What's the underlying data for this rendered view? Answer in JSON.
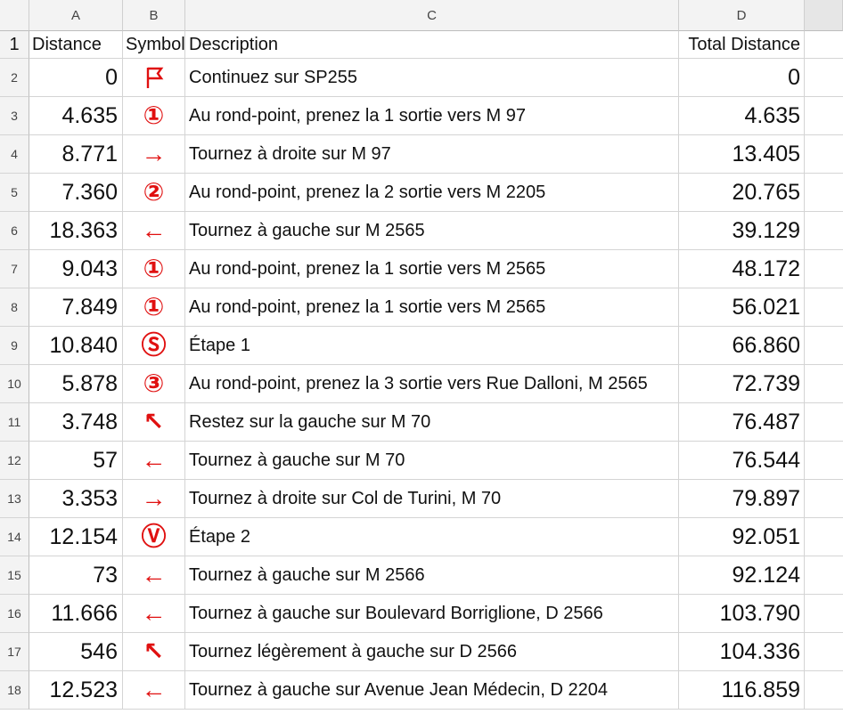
{
  "columns": [
    "A",
    "B",
    "C",
    "D"
  ],
  "header_labels": {
    "distance": "Distance",
    "symbol": "Symbol",
    "description": "Description",
    "total": "Total Distance"
  },
  "row_numbers": [
    "1",
    "2",
    "3",
    "4",
    "5",
    "6",
    "7",
    "8",
    "9",
    "10",
    "11",
    "12",
    "13",
    "14",
    "15",
    "16",
    "17",
    "18"
  ],
  "rows": [
    {
      "distance": "0",
      "symbol": "",
      "icon": "flag-icon",
      "description": "Continuez sur SP255",
      "total": "0"
    },
    {
      "distance": "4.635",
      "symbol": "①",
      "icon": "roundabout-exit-1-icon",
      "description": "Au rond-point, prenez la 1 sortie vers M 97",
      "total": "4.635"
    },
    {
      "distance": "8.771",
      "symbol": "→",
      "icon": "arrow-right-icon",
      "description": "Tournez à droite sur M 97",
      "total": "13.405"
    },
    {
      "distance": "7.360",
      "symbol": "②",
      "icon": "roundabout-exit-2-icon",
      "description": "Au rond-point, prenez la 2 sortie vers M 2205",
      "total": "20.765"
    },
    {
      "distance": "18.363",
      "symbol": "←",
      "icon": "arrow-left-icon",
      "description": "Tournez à gauche sur M 2565",
      "total": "39.129"
    },
    {
      "distance": "9.043",
      "symbol": "①",
      "icon": "roundabout-exit-1-icon",
      "description": "Au rond-point, prenez la 1 sortie vers M 2565",
      "total": "48.172"
    },
    {
      "distance": "7.849",
      "symbol": "①",
      "icon": "roundabout-exit-1-icon",
      "description": "Au rond-point, prenez la 1 sortie vers M 2565",
      "total": "56.021"
    },
    {
      "distance": "10.840",
      "symbol": "Ⓢ",
      "icon": "stage-s-icon",
      "description": "Étape 1",
      "total": "66.860"
    },
    {
      "distance": "5.878",
      "symbol": "③",
      "icon": "roundabout-exit-3-icon",
      "description": "Au rond-point, prenez la 3 sortie vers Rue Dalloni, M 2565",
      "total": "72.739"
    },
    {
      "distance": "3.748",
      "symbol": "↖",
      "icon": "arrow-up-left-icon",
      "description": "Restez sur la gauche sur M 70",
      "total": "76.487"
    },
    {
      "distance": "57",
      "symbol": "←",
      "icon": "arrow-left-icon",
      "description": "Tournez à gauche sur M 70",
      "total": "76.544"
    },
    {
      "distance": "3.353",
      "symbol": "→",
      "icon": "arrow-right-icon",
      "description": "Tournez à droite sur Col de Turini, M 70",
      "total": "79.897"
    },
    {
      "distance": "12.154",
      "symbol": "Ⓥ",
      "icon": "stage-v-icon",
      "description": "Étape 2",
      "total": "92.051"
    },
    {
      "distance": "73",
      "symbol": "←",
      "icon": "arrow-left-icon",
      "description": "Tournez à gauche sur M 2566",
      "total": "92.124"
    },
    {
      "distance": "11.666",
      "symbol": "←",
      "icon": "arrow-left-icon",
      "description": "Tournez à gauche sur Boulevard Borriglione, D 2566",
      "total": "103.790"
    },
    {
      "distance": "546",
      "symbol": "↖",
      "icon": "arrow-up-left-icon",
      "description": "Tournez légèrement à gauche sur D 2566",
      "total": "104.336"
    },
    {
      "distance": "12.523",
      "symbol": "←",
      "icon": "arrow-left-icon",
      "description": "Tournez à gauche sur Avenue Jean Médecin, D 2204",
      "total": "116.859"
    }
  ],
  "colors": {
    "symbol": "#e01010",
    "header_bg": "#f3f3f3",
    "grid": "#d4d4d4"
  }
}
